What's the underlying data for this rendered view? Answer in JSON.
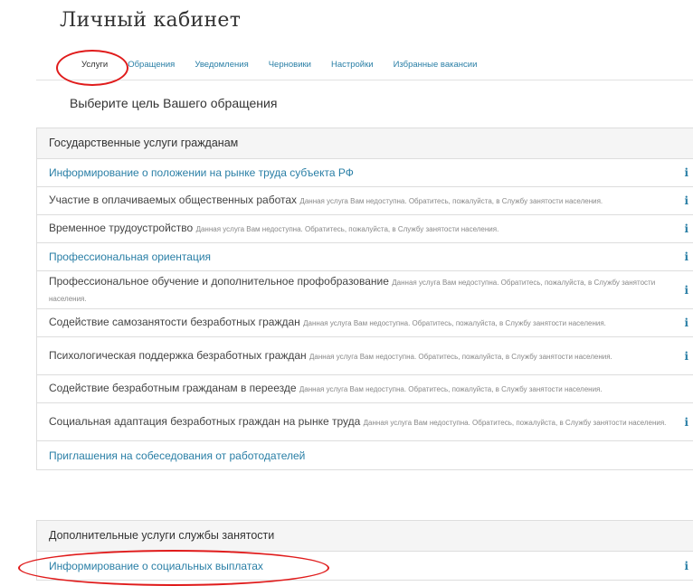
{
  "page": {
    "title": "Личный кабинет",
    "subtitle": "Выберите цель Вашего обращения"
  },
  "tabs": [
    {
      "label": "Услуги",
      "active": true
    },
    {
      "label": "Обращения"
    },
    {
      "label": "Уведомления"
    },
    {
      "label": "Черновики"
    },
    {
      "label": "Настройки"
    },
    {
      "label": "Избранные вакансии"
    }
  ],
  "sections": {
    "gov": {
      "heading": "Государственные услуги гражданам",
      "items": [
        {
          "label": "Информирование о положении на рынке труда субъекта РФ",
          "note": "",
          "available": true
        },
        {
          "label": "Участие в оплачиваемых общественных работах",
          "note": "Данная услуга Вам недоступна. Обратитесь, пожалуйста, в Службу занятости населения.",
          "available": false
        },
        {
          "label": "Временное трудоустройство",
          "note": "Данная услуга Вам недоступна. Обратитесь, пожалуйста, в Службу занятости населения.",
          "available": false
        },
        {
          "label": "Профессиональная ориентация",
          "note": "",
          "available": true
        },
        {
          "label": "Профессиональное обучение и дополнительное профобразование",
          "note": "Данная услуга Вам недоступна. Обратитесь, пожалуйста, в Службу занятости населения.",
          "available": false
        },
        {
          "label": "Содействие самозанятости безработных граждан",
          "note": "Данная услуга Вам недоступна. Обратитесь, пожалуйста, в Службу занятости населения.",
          "available": false
        },
        {
          "label": "Психологическая поддержка безработных граждан",
          "note": "Данная услуга Вам недоступна. Обратитесь, пожалуйста, в Службу занятости населения.",
          "available": false
        },
        {
          "label": "Содействие безработным гражданам в переезде",
          "note": "Данная услуга Вам недоступна. Обратитесь, пожалуйста, в Службу занятости населения.",
          "available": false
        },
        {
          "label": "Социальная адаптация безработных граждан на рынке труда",
          "note": "Данная услуга Вам недоступна. Обратитесь, пожалуйста, в Службу занятости населения.",
          "available": false
        },
        {
          "label": "Приглашения на собеседования от работодателей",
          "note": "",
          "available": true
        }
      ]
    },
    "extra": {
      "heading": "Дополнительные услуги службы занятости",
      "items": [
        {
          "label": "Информирование о социальных выплатах",
          "note": "",
          "available": true
        }
      ]
    }
  },
  "icons": {
    "info": "i"
  },
  "colors": {
    "link": "#2a7fa6",
    "highlight_ring": "#e01b1b",
    "panel_header_bg": "#f5f5f5"
  }
}
